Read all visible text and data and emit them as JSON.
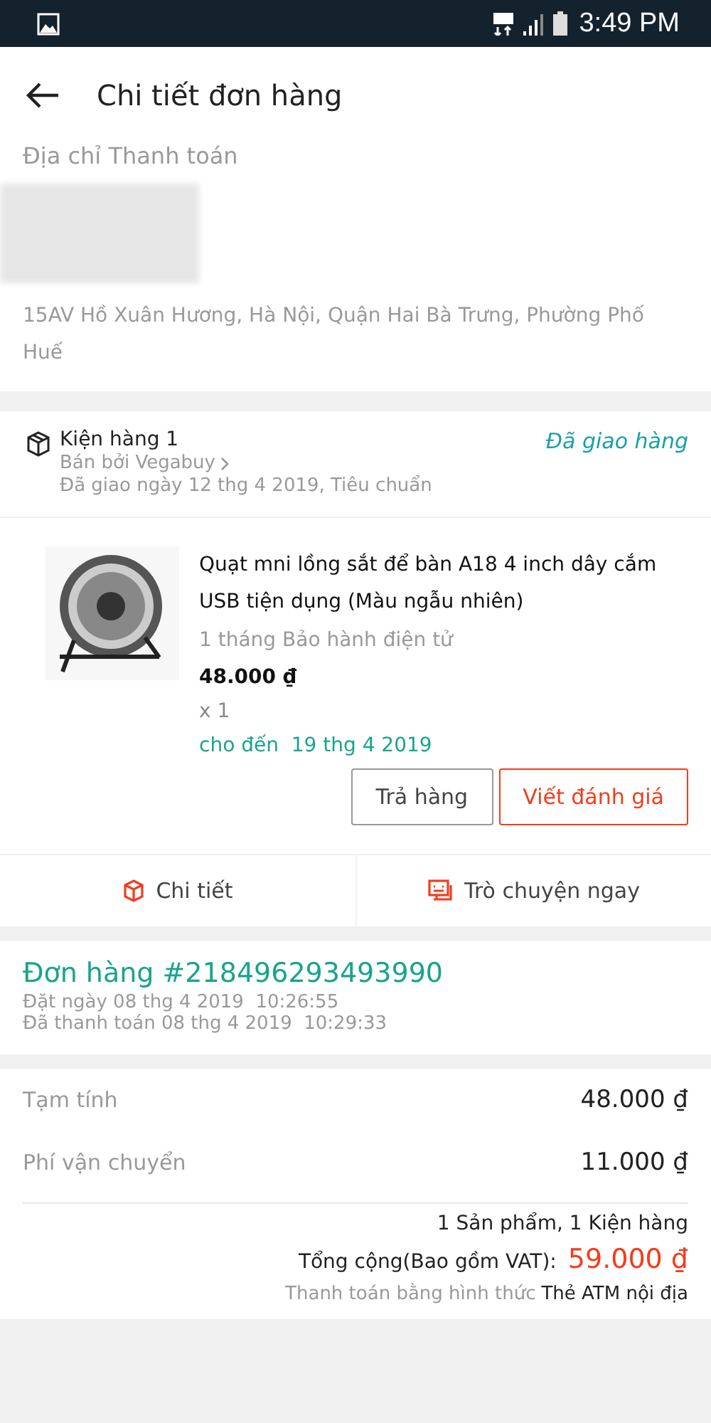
{
  "status_bar": {
    "time": "3:49 PM"
  },
  "header": {
    "title": "Chi tiết đơn hàng"
  },
  "address": {
    "label": "Địa chỉ Thanh toán",
    "text": "15AV Hồ Xuân Hương, Hà Nội, Quận Hai Bà Trưng, Phường Phố Huế"
  },
  "package": {
    "title": "Kiện hàng 1",
    "seller": "Bán bởi Vegabuy",
    "delivery": "Đã giao ngày 12 thg 4 2019, Tiêu chuẩn",
    "status": "Đã giao hàng",
    "product": {
      "name": "Quạt mni lồng sắt để bàn A18 4 inch dây cắm USB tiện dụng (Màu ngẫu nhiên)",
      "warranty": "1 tháng Bảo hành điện tử",
      "price": "48.000 ₫",
      "quantity": "x 1",
      "return_until": "cho đến  19 thg 4 2019"
    },
    "buttons": [
      {
        "label": "Trả hàng",
        "kind": "outline"
      },
      {
        "label": "Viết đánh giá",
        "kind": "primary"
      }
    ],
    "actions": [
      {
        "label": "Chi tiết",
        "kind": "details"
      },
      {
        "label": "Trò chuyện ngay",
        "kind": "chat"
      }
    ]
  },
  "order": {
    "number": "Đơn hàng #218496293493990",
    "placed": "Đặt ngày 08 thg 4 2019  10:26:55",
    "paid": "Đã thanh toán 08 thg 4 2019  10:29:33"
  },
  "summary": {
    "rows": [
      {
        "label": "Tạm tính",
        "value": "48.000 ₫"
      },
      {
        "label": "Phí vận chuyển",
        "value": "11.000 ₫"
      }
    ],
    "count": "1 Sản phẩm, 1 Kiện hàng",
    "total_label": "Tổng cộng(Bao gồm VAT):",
    "total": "59.000 ₫",
    "payment_label": "Thanh toán bằng hình thức",
    "payment_method": "Thẻ ATM nội địa"
  }
}
